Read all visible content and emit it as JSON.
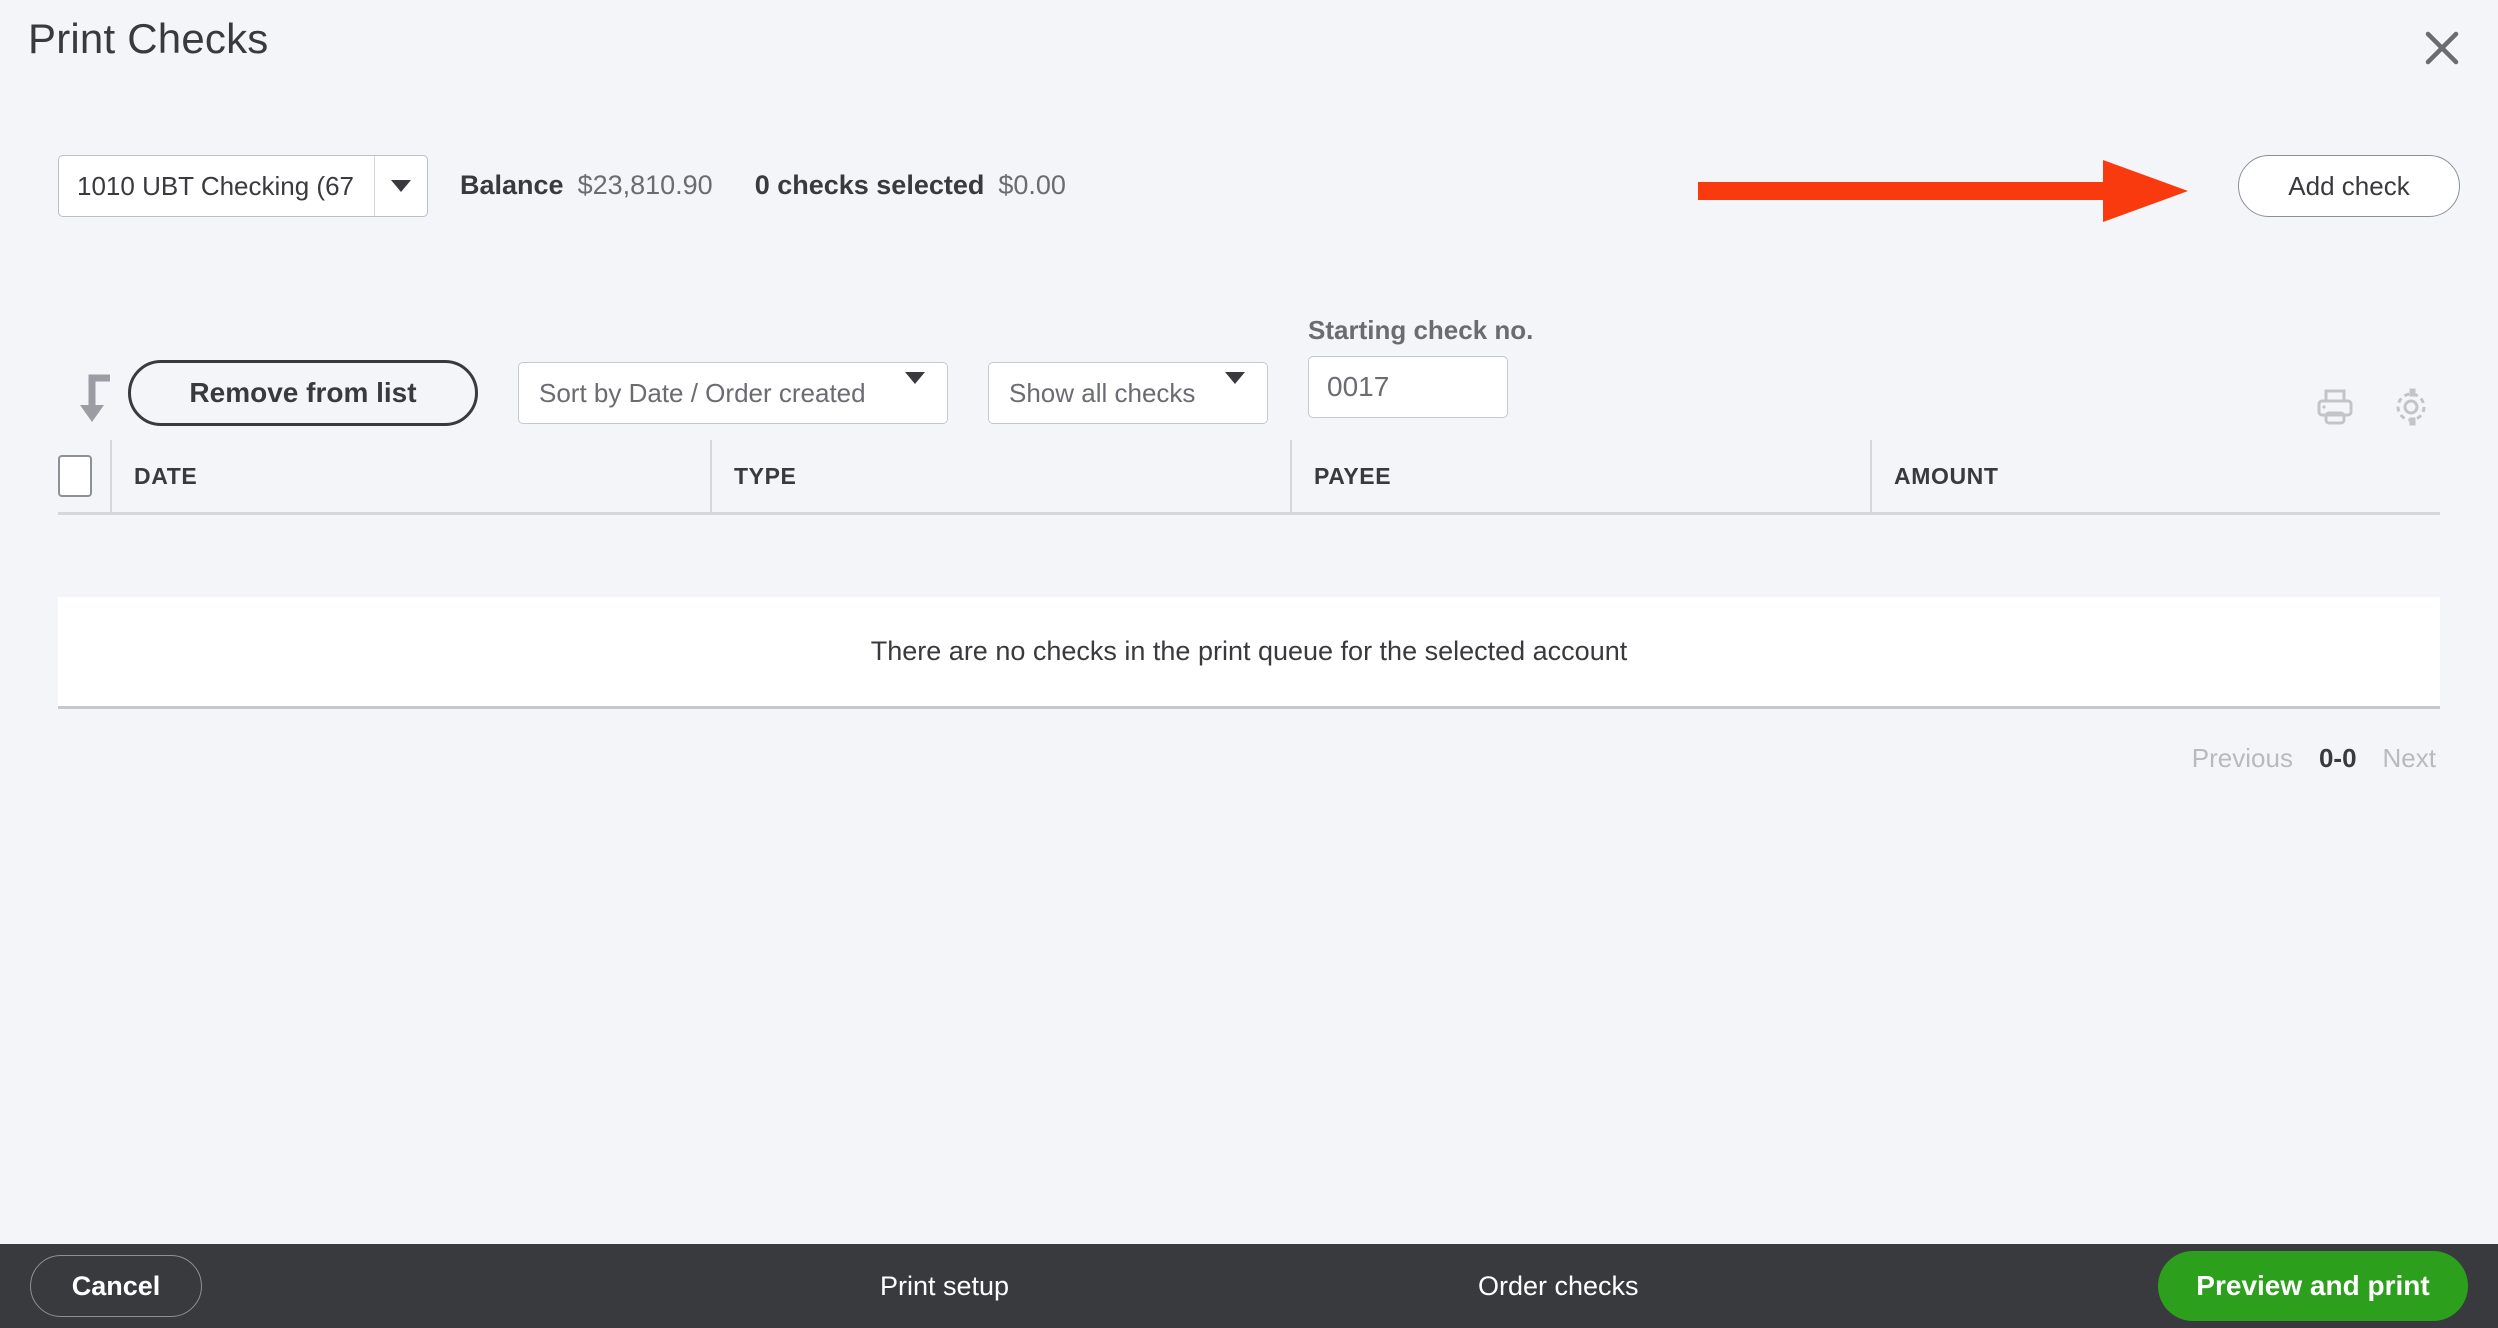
{
  "header": {
    "title": "Print Checks",
    "close_icon": "close-icon"
  },
  "account_bar": {
    "account_value": "1010 UBT Checking (67",
    "caret_icon": "chevron-down-icon",
    "balance_label": "Balance",
    "balance_value": "$23,810.90",
    "selected_label": "0 checks selected",
    "selected_value": "$0.00",
    "add_check_label": "Add check"
  },
  "annotation": {
    "arrow_icon": "red-arrow-right",
    "arrow_color": "#F93A0E"
  },
  "toolbar": {
    "turn_icon": "arrow-turn-down-icon",
    "remove_label": "Remove from list",
    "sort_label": "Sort by Date / Order created",
    "show_label": "Show all checks",
    "starting_check_label": "Starting check no.",
    "starting_check_value": "0017",
    "print_icon": "printer-icon",
    "settings_icon": "gear-icon"
  },
  "table": {
    "columns": [
      "DATE",
      "TYPE",
      "PAYEE",
      "AMOUNT"
    ],
    "rows": [],
    "empty_message": "There are no checks in the print queue for the selected account"
  },
  "pagination": {
    "previous_label": "Previous",
    "range_label": "0-0",
    "next_label": "Next"
  },
  "footer": {
    "cancel_label": "Cancel",
    "print_setup_label": "Print setup",
    "order_checks_label": "Order checks",
    "preview_label": "Preview and print",
    "preview_color": "#2CA01C",
    "background_color": "#393A3D"
  }
}
